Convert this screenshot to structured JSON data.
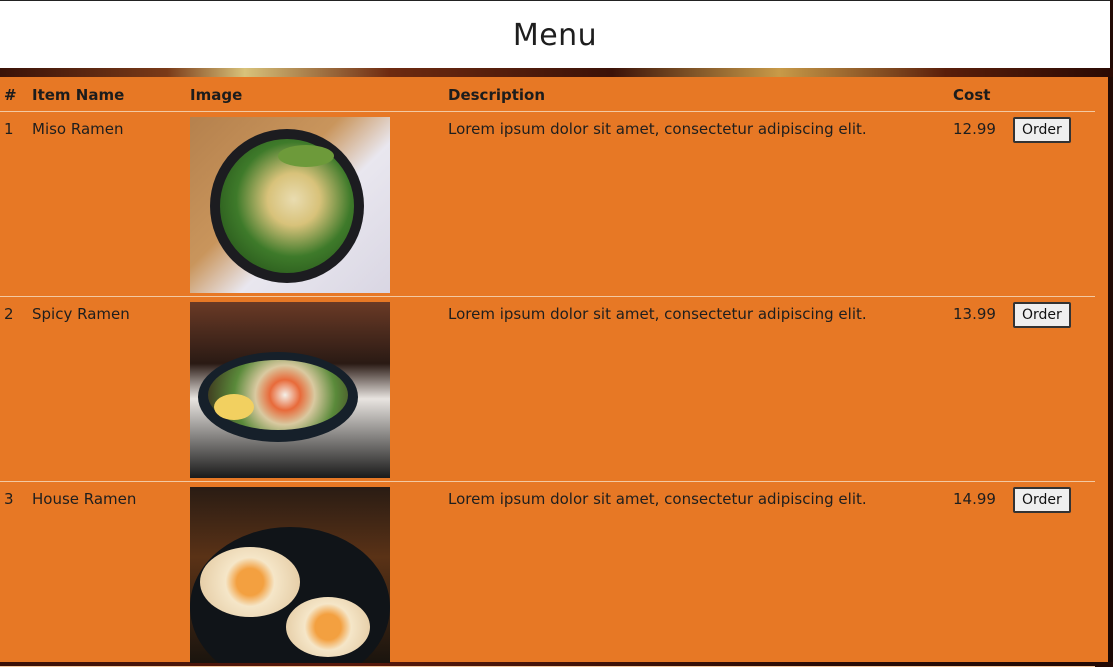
{
  "header": {
    "title": "Menu"
  },
  "table": {
    "columns": [
      "#",
      "Item Name",
      "Image",
      "Description",
      "Cost"
    ],
    "rows": [
      {
        "num": "1",
        "name": "Miso Ramen",
        "image": "miso-ramen-photo",
        "description": "Lorem ipsum dolor sit amet, consectetur adipiscing elit.",
        "cost": "12.99",
        "button": "Order"
      },
      {
        "num": "2",
        "name": "Spicy Ramen",
        "image": "spicy-ramen-photo",
        "description": "Lorem ipsum dolor sit amet, consectetur adipiscing elit.",
        "cost": "13.99",
        "button": "Order"
      },
      {
        "num": "3",
        "name": "House Ramen",
        "image": "house-ramen-photo",
        "description": "Lorem ipsum dolor sit amet, consectetur adipiscing elit.",
        "cost": "14.99",
        "button": "Order"
      }
    ]
  },
  "colors": {
    "panel": "#e77825",
    "header_bg": "#ffffff"
  }
}
